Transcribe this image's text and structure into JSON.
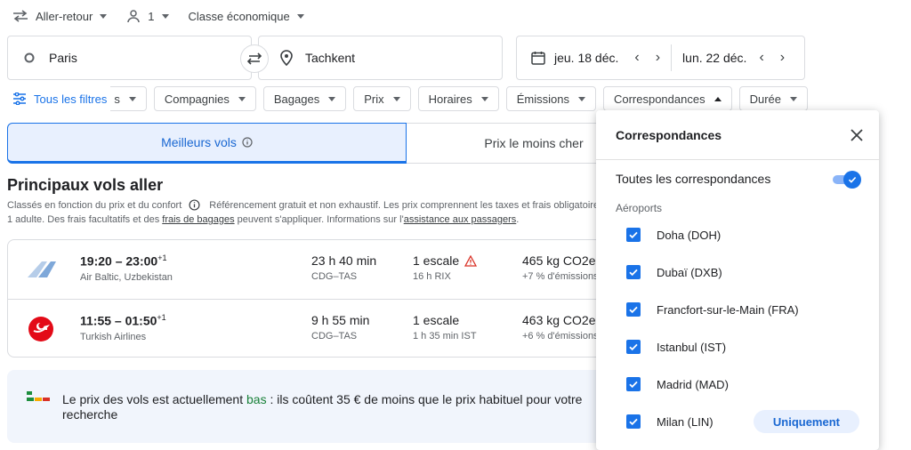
{
  "topbar": {
    "trip_type": "Aller-retour",
    "passengers": "1",
    "cabin_class": "Classe économique"
  },
  "search": {
    "from": "Paris",
    "to": "Tachkent",
    "depart_date": "jeu. 18 déc.",
    "return_date": "lun. 22 déc."
  },
  "filters": {
    "all_filters": "Tous les filtres",
    "truncated_chip": "s",
    "chips": [
      "Compagnies",
      "Bagages",
      "Prix",
      "Horaires",
      "Émissions",
      "Correspondances",
      "Durée"
    ]
  },
  "tabs": {
    "best": "Meilleurs vols",
    "cheapest": "Prix le moins cher"
  },
  "results": {
    "title": "Principaux vols aller",
    "subtitle": "Classés en fonction du prix et du confort",
    "subtitle_rest": "Référencement gratuit et non exhaustif. Les prix comprennent les taxes et frais obligatoires",
    "note_prefix": "1 adulte. Des frais facultatifs et des ",
    "note_link1": "frais de bagages",
    "note_mid": " peuvent s'appliquer. Informations sur l'",
    "note_link2": "assistance aux passagers",
    "note_suffix": "."
  },
  "flights": [
    {
      "times": "19:20 – 23:00",
      "plus": "+1",
      "airline": "Air Baltic, Uzbekistan",
      "duration": "23 h 40 min",
      "route": "CDG–TAS",
      "stops": "1 escale",
      "stop_detail": "16 h RIX",
      "emissions": "465 kg CO2e",
      "emissions_delta": "+7 % d'émissions",
      "warning": true
    },
    {
      "times": "11:55 – 01:50",
      "plus": "+1",
      "airline": "Turkish Airlines",
      "duration": "9 h 55 min",
      "route": "CDG–TAS",
      "stops": "1 escale",
      "stop_detail": "1 h 35 min IST",
      "emissions": "463 kg CO2e",
      "emissions_delta": "+6 % d'émissions",
      "warning": false
    }
  ],
  "banner": {
    "prefix": "Le prix des vols est actuellement ",
    "level": "bas",
    "suffix": " : ils coûtent 35 € de moins que le prix habituel pour votre recherche"
  },
  "panel": {
    "title": "Correspondances",
    "all_connections": "Toutes les correspondances",
    "all_connections_on": true,
    "airports_label": "Aéroports",
    "airports": [
      "Doha (DOH)",
      "Dubaï (DXB)",
      "Francfort-sur-le-Main (FRA)",
      "Istanbul (IST)",
      "Madrid (MAD)",
      "Milan (LIN)"
    ],
    "only_button": "Uniquement"
  },
  "colors": {
    "accent": "#1a73e8",
    "low_price": "#188038",
    "warning": "#d93025",
    "turkish_red": "#e30a17"
  },
  "icons": [
    "swap-horiz-icon",
    "person-icon",
    "origin-circle-icon",
    "location-pin-icon",
    "calendar-icon",
    "chevron-left-icon",
    "chevron-right-icon",
    "tune-icon",
    "info-icon",
    "warning-icon",
    "close-icon",
    "check-icon",
    "price-level-icon"
  ]
}
